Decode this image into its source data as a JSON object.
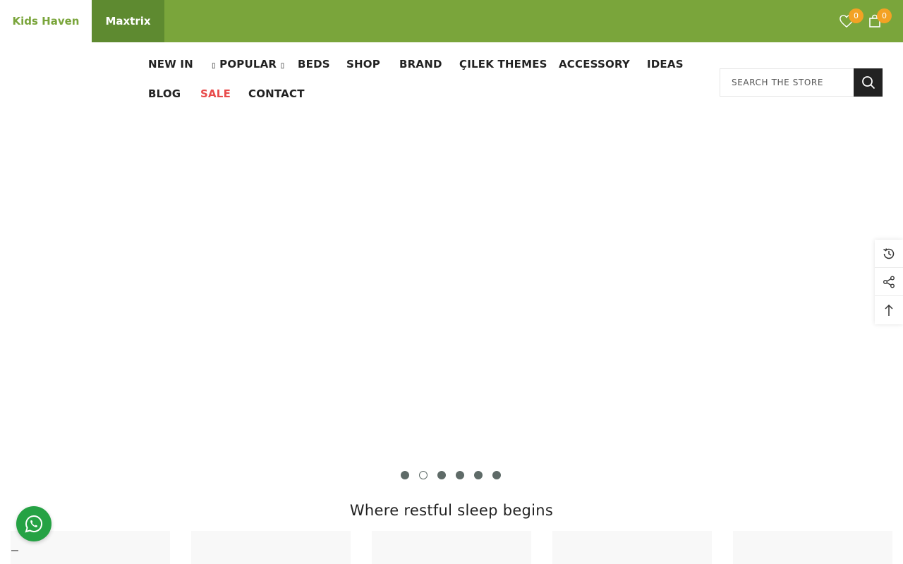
{
  "topbar": {
    "brand_tabs": [
      "Kids Haven",
      "Maxtrix"
    ],
    "wishlist_count": "0",
    "cart_count": "0",
    "bg_color": "#7aa53b"
  },
  "nav": {
    "items": [
      "NEW IN",
      "POPULAR",
      "BEDS",
      "SHOP",
      "BRAND",
      "ÇILEK THEMES",
      "ACCESSORY",
      "IDEAS",
      "BLOG",
      "SALE",
      "CONTACT"
    ],
    "popular_prefix": "",
    "popular_suffix": "",
    "sale_color": "#e84b4b"
  },
  "search": {
    "placeholder": "SEARCH THE STORE"
  },
  "slider": {
    "dot_count": 6,
    "active_index": 1
  },
  "section": {
    "title": "Where restful sleep begins"
  },
  "icons": {
    "wishlist": "heart-icon",
    "cart": "shopping-bag-icon",
    "search": "search-icon",
    "recent": "history-icon",
    "share": "share-icon",
    "top": "arrow-up-icon",
    "whatsapp": "whatsapp-icon"
  }
}
